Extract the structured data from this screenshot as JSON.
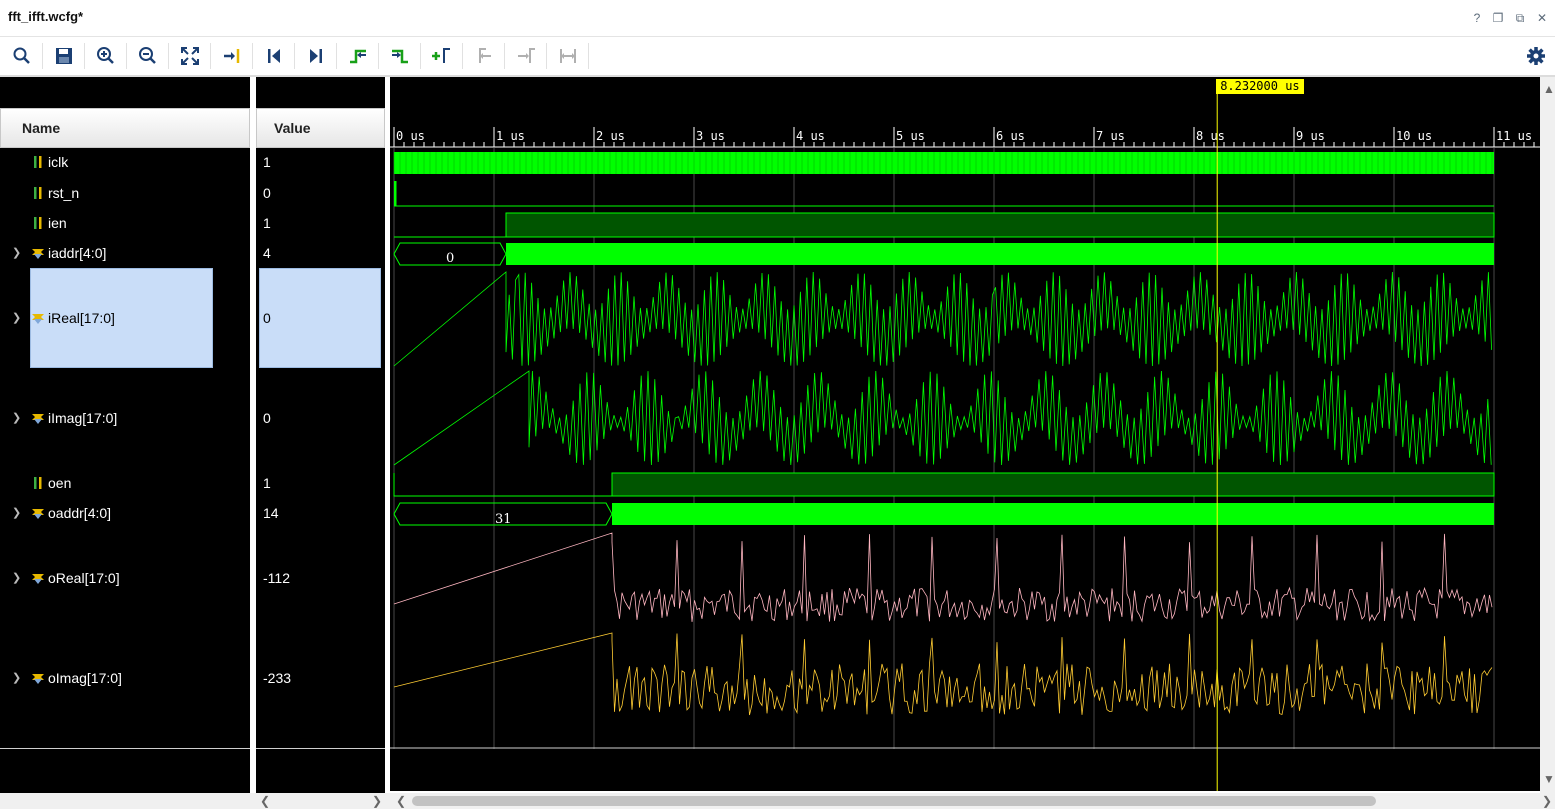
{
  "window": {
    "title": "fft_ifft.wcfg*",
    "controls": [
      "help-icon",
      "restore-icon",
      "maximize-icon",
      "close-icon"
    ]
  },
  "toolbar": {
    "buttons": [
      "search-icon",
      "save-icon",
      "zoom-in-icon",
      "zoom-out-icon",
      "zoom-fit-icon",
      "go-to-cursor-icon",
      "go-to-start-icon",
      "go-to-end-icon",
      "previous-transition-icon",
      "next-transition-icon",
      "add-marker-icon",
      "previous-marker-icon",
      "next-marker-icon",
      "swap-cursors-icon",
      "settings-icon"
    ]
  },
  "columns": {
    "name": "Name",
    "value": "Value"
  },
  "signals": [
    {
      "name": "iclk",
      "value": "1",
      "bus": false,
      "selected": false
    },
    {
      "name": "rst_n",
      "value": "0",
      "bus": false,
      "selected": false
    },
    {
      "name": "ien",
      "value": "1",
      "bus": false,
      "selected": false
    },
    {
      "name": "iaddr[4:0]",
      "value": "4",
      "bus": true,
      "selected": false
    },
    {
      "name": "iReal[17:0]",
      "value": "0",
      "bus": true,
      "selected": true
    },
    {
      "name": "iImag[17:0]",
      "value": "0",
      "bus": true,
      "selected": false
    },
    {
      "name": "oen",
      "value": "1",
      "bus": false,
      "selected": false
    },
    {
      "name": "oaddr[4:0]",
      "value": "14",
      "bus": true,
      "selected": false
    },
    {
      "name": "oReal[17:0]",
      "value": "-112",
      "bus": true,
      "selected": false
    },
    {
      "name": "oImag[17:0]",
      "value": "-233",
      "bus": true,
      "selected": false
    }
  ],
  "timeline": {
    "cursor_label": "8.232000 us",
    "cursor_time_us": 8.232,
    "ticks": [
      "0 us",
      "1 us",
      "2 us",
      "3 us",
      "4 us",
      "5 us",
      "6 us",
      "7 us",
      "8 us",
      "9 us",
      "10 us",
      "11 us"
    ]
  },
  "bus_labels": {
    "iaddr_initial": "0",
    "oaddr_initial": "31"
  },
  "colors": {
    "green": "#00ff00",
    "dark_green": "#005500",
    "pink": "#ffb6c1",
    "yellow": "#ffcc33",
    "cursor": "#ffff00",
    "selection": "#c9ddf8"
  }
}
